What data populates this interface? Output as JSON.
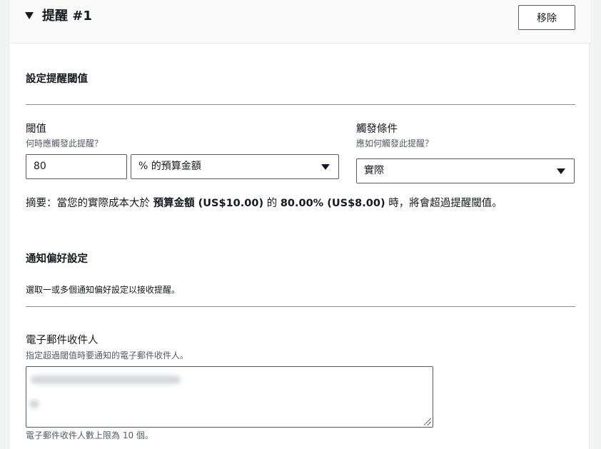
{
  "header": {
    "title": "提醒 #1",
    "remove_label": "移除"
  },
  "threshold_section": {
    "title": "設定提醒閾值",
    "threshold": {
      "label": "閾值",
      "description": "何時應觸發此提醒？",
      "value": "80",
      "unit_selected": "% 的預算金額"
    },
    "trigger": {
      "label": "觸發條件",
      "description": "應如何觸發此提醒？",
      "selected": "實際"
    },
    "summary": {
      "prefix": "摘要：當您的實際成本大於",
      "budget_amount": "預算金額 (US$10.00)",
      "middle": "的",
      "threshold_amount": "80.00% (US$8.00)",
      "suffix": "時，將會超過提醒閾值。"
    }
  },
  "notification_section": {
    "title": "通知偏好設定",
    "description": "選取一或多個通知偏好設定以接收提醒。",
    "email": {
      "label": "電子郵件收件人",
      "description": "指定超過閾值時要通知的電子郵件收件人。",
      "limit_note": "電子郵件收件人數上限為 10 個。"
    }
  }
}
